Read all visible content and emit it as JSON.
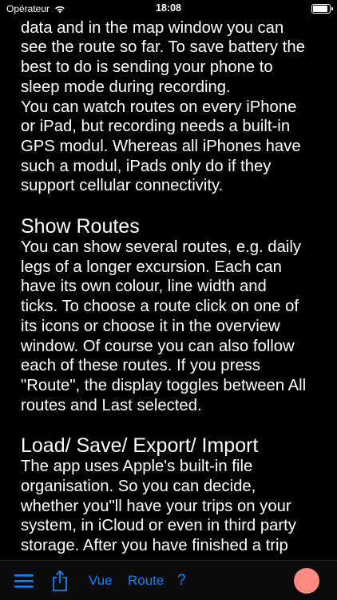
{
  "status_bar": {
    "carrier": "Opérateur",
    "time": "18:08",
    "battery_level": 0.95
  },
  "content": {
    "paragraphs_top": [
      "The record window shows the current\ndata and in the map window you can\nsee the route so far. To save battery the\nbest to do is sending your phone to\nsleep mode during recording.\nYou can watch routes on every iPhone\nor iPad, but recording needs a built-in\nGPS modul. Whereas  all iPhones have\nsuch a modul, iPads only do if they\nsupport cellular connectivity."
    ],
    "sections": [
      {
        "title": "Show Routes",
        "body": "You can show several routes, e.g. daily\nlegs of a longer excursion. Each can\nhave its own colour, line width and\nticks. To choose a route click on one of\nits icons or choose it in the overview\nwindow. Of course you can also follow\neach of these routes. If you press\n\"Route\", the display toggles between All\nroutes and Last selected."
      },
      {
        "title": "Load/ Save/ Export/ Import",
        "body": "The app uses Apple's built-in file\norganisation. So you can decide,\nwhether you\"ll have your trips on your\nsystem, in iCloud or even in third party\nstorage. After you have finished a trip"
      }
    ]
  },
  "toolbar": {
    "menu_icon": "hamburger-menu-icon",
    "share_icon": "share-icon",
    "vue_label": "Vue",
    "route_label": "Route",
    "help_label": "?",
    "record_icon": "record-circle-icon",
    "accent_color": "#0a84ff",
    "record_color": "#ff8a80"
  }
}
